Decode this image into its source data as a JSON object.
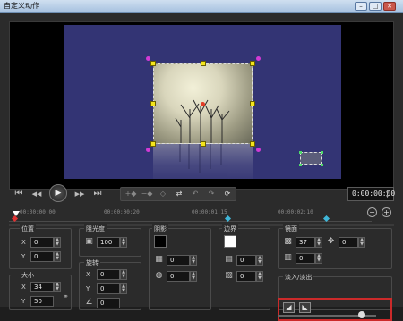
{
  "window": {
    "title": "自定义动作",
    "minimize": "–",
    "maximize": "□",
    "close": "✕"
  },
  "colors": {
    "canvas_bg": "#333474",
    "handle": "#f4e51c",
    "rotate_handle": "#d33ad6",
    "center": "#e33c25",
    "keyframe": "#3fb6d8",
    "highlight_box": "#cc2a2a"
  },
  "transport": {
    "icons": [
      "prev-keyframe-icon",
      "step-back-icon",
      "play-icon",
      "step-forward-icon",
      "next-keyframe-icon"
    ],
    "glyphs": {
      "prev": "⏮",
      "back": "◀◀",
      "play": "▶",
      "fwd": "▶▶",
      "next": "⏭"
    },
    "timecode": "0:00:00:00",
    "spin_up": "▲",
    "spin_down": "▼"
  },
  "edit_tools": {
    "glyphs": [
      "+◆",
      "−◆",
      "◇",
      "⇄",
      "↶",
      "↷",
      "⟳"
    ]
  },
  "timeline": {
    "ticks": [
      "00:00:00:00",
      "00:00:00:20",
      "00:00:01:15",
      "00:00:02:10"
    ],
    "zoom_out": "−",
    "zoom_in": "+"
  },
  "panels": {
    "position": {
      "label": "位置",
      "x_label": "X",
      "x_value": "0",
      "y_label": "Y",
      "y_value": "0"
    },
    "size": {
      "label": "大小",
      "x_label": "X",
      "x_value": "34",
      "y_label": "Y",
      "y_value": "50"
    },
    "opacity": {
      "label": "阻光度",
      "value": "100"
    },
    "rotation": {
      "label": "旋转",
      "x_label": "X",
      "x_value": "0",
      "y_label": "Y",
      "y_value": "0",
      "z_value": "0"
    },
    "shadow": {
      "label": "阴影",
      "swatch_color": "#000000",
      "value1": "0",
      "value2": "0"
    },
    "border": {
      "label": "边界",
      "swatch_color": "#ffffff",
      "value1": "0",
      "value2": "0"
    },
    "mirror": {
      "label": "镜面",
      "value1": "37",
      "value2": "0",
      "value3": "0"
    },
    "fade": {
      "label": "淡入/淡出",
      "fade_in": "◢",
      "fade_out": "◣"
    }
  },
  "spin": {
    "up": "▲",
    "down": "▼"
  }
}
